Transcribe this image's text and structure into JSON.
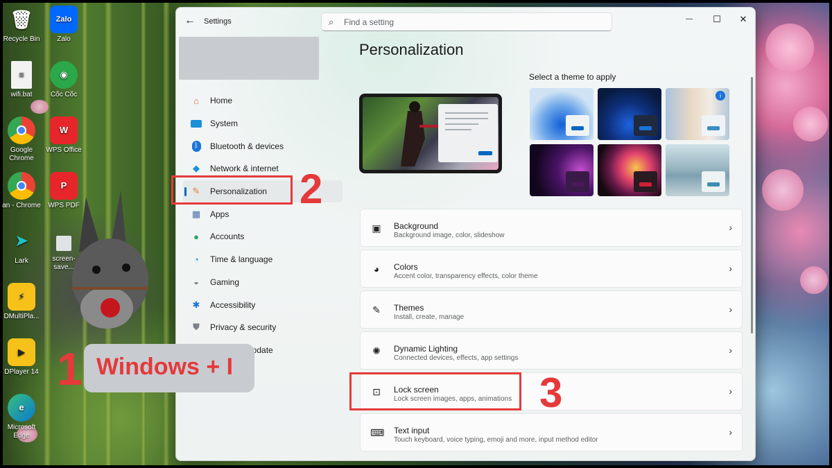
{
  "desktop": {
    "icons": [
      {
        "label": "Recycle Bin",
        "icon": "recycle-bin-icon"
      },
      {
        "label": "Zalo",
        "icon": "zalo-icon"
      },
      {
        "label": "wifi.bat",
        "icon": "bat-file-icon"
      },
      {
        "label": "Cốc Cốc",
        "icon": "coccoc-icon"
      },
      {
        "label": "Google Chrome",
        "icon": "chrome-icon"
      },
      {
        "label": "WPS Office",
        "icon": "wps-office-icon"
      },
      {
        "label": "an - Chrome",
        "icon": "chrome-profile-icon"
      },
      {
        "label": "WPS PDF",
        "icon": "wps-pdf-icon"
      },
      {
        "label": "Lark",
        "icon": "lark-icon"
      },
      {
        "label": "screen-save...",
        "icon": "screensaver-icon"
      },
      {
        "label": "DMultiPla...",
        "icon": "ldmultiplayer-icon"
      },
      {
        "label": "DPlayer 14",
        "icon": "ldplayer-icon"
      },
      {
        "label": "Microsoft Edge",
        "icon": "edge-icon"
      }
    ]
  },
  "window": {
    "app_title": "Settings",
    "search_placeholder": "Find a setting",
    "back_icon": "←",
    "controls": {
      "minimize": "—",
      "maximize": "☐",
      "close": "✕"
    }
  },
  "nav": {
    "items": [
      {
        "label": "Home",
        "icon": "home-icon"
      },
      {
        "label": "System",
        "icon": "system-icon"
      },
      {
        "label": "Bluetooth & devices",
        "icon": "bluetooth-icon"
      },
      {
        "label": "Network & internet",
        "icon": "network-icon"
      },
      {
        "label": "Personalization",
        "icon": "brush-icon",
        "active": true
      },
      {
        "label": "Apps",
        "icon": "apps-icon"
      },
      {
        "label": "Accounts",
        "icon": "accounts-icon"
      },
      {
        "label": "Time & language",
        "icon": "time-language-icon"
      },
      {
        "label": "Gaming",
        "icon": "gaming-icon"
      },
      {
        "label": "Accessibility",
        "icon": "accessibility-icon"
      },
      {
        "label": "Privacy & security",
        "icon": "shield-icon"
      },
      {
        "label": "Windows Update",
        "icon": "update-icon"
      }
    ]
  },
  "main": {
    "title": "Personalization",
    "theme_prompt": "Select a theme to apply",
    "settings": [
      {
        "title": "Background",
        "subtitle": "Background image, color, slideshow",
        "icon": "image-icon"
      },
      {
        "title": "Colors",
        "subtitle": "Accent color, transparency effects, color theme",
        "icon": "palette-icon"
      },
      {
        "title": "Themes",
        "subtitle": "Install, create, manage",
        "icon": "brush-icon"
      },
      {
        "title": "Dynamic Lighting",
        "subtitle": "Connected devices, effects, app settings",
        "icon": "sun-icon"
      },
      {
        "title": "Lock screen",
        "subtitle": "Lock screen images, apps, animations",
        "icon": "lock-screen-icon"
      },
      {
        "title": "Text input",
        "subtitle": "Touch keyboard, voice typing, emoji and more, input method editor",
        "icon": "keyboard-icon"
      }
    ]
  },
  "annotations": {
    "step1": "1",
    "step2": "2",
    "step3": "3",
    "shortcut": "Windows + I"
  },
  "colors": {
    "accent": "#0067c0",
    "annotation_red": "#e5393a"
  }
}
